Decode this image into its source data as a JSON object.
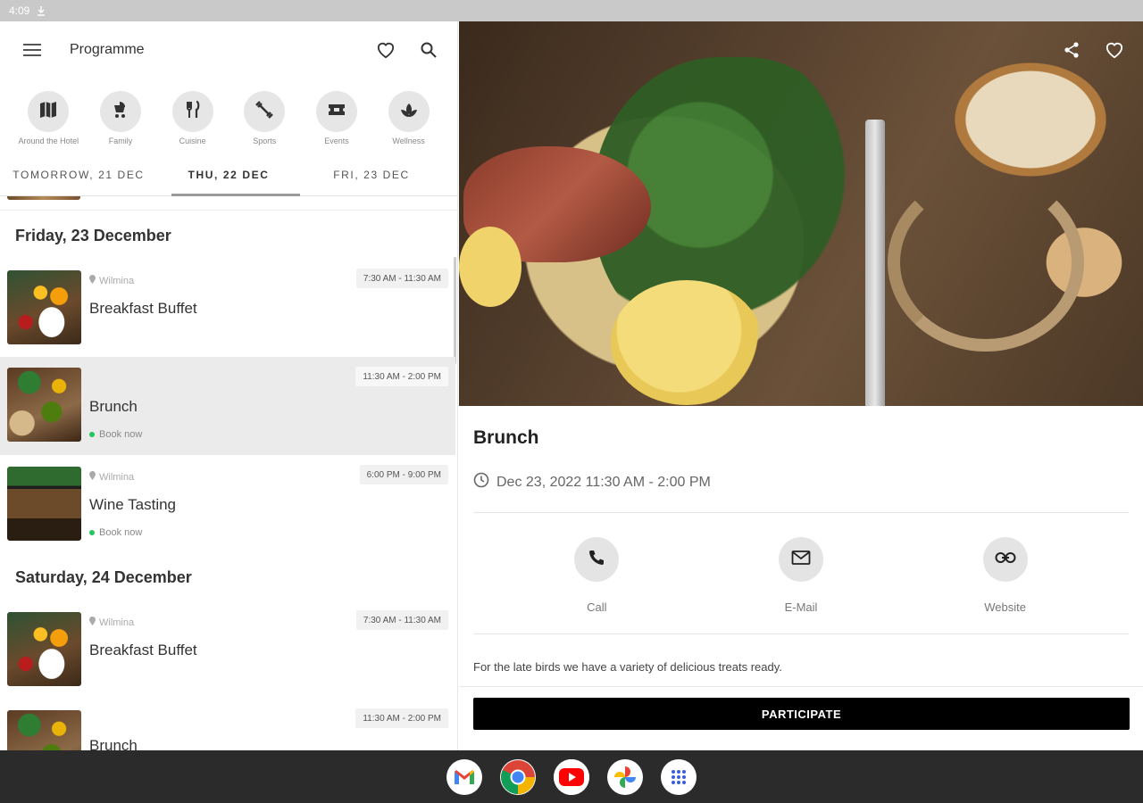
{
  "status": {
    "time": "4:09"
  },
  "appbar": {
    "title": "Programme"
  },
  "categories": [
    {
      "label": "Around the Hotel",
      "icon": "map-icon"
    },
    {
      "label": "Family",
      "icon": "stroller-icon"
    },
    {
      "label": "Cuisine",
      "icon": "fork-knife-icon"
    },
    {
      "label": "Sports",
      "icon": "fitness-icon"
    },
    {
      "label": "Events",
      "icon": "ticket-icon"
    },
    {
      "label": "Wellness",
      "icon": "lotus-icon"
    }
  ],
  "tabs": [
    "Tomorrow, 21 Dec",
    "Thu, 22 Dec",
    "Fri, 23 Dec"
  ],
  "list": {
    "day1": "Friday, 23 December",
    "day2": "Saturday, 24 December",
    "items": [
      {
        "name": "Breakfast Buffet",
        "location": "Wilmina",
        "time": "7:30 AM - 11:30 AM"
      },
      {
        "name": "Brunch",
        "time": "11:30 AM - 2:00 PM",
        "book": "Book now"
      },
      {
        "name": "Wine Tasting",
        "location": "Wilmina",
        "time": "6:00 PM - 9:00 PM",
        "book": "Book now"
      },
      {
        "name": "Breakfast Buffet",
        "location": "Wilmina",
        "time": "7:30 AM - 11:30 AM"
      },
      {
        "name": "Brunch",
        "time": "11:30 AM - 2:00 PM"
      }
    ]
  },
  "detail": {
    "title": "Brunch",
    "when": "Dec 23, 2022 11:30 AM - 2:00 PM",
    "contacts": {
      "call": "Call",
      "email": "E-Mail",
      "website": "Website"
    },
    "description": "For the late birds we have a variety of delicious treats ready.",
    "participate": "PARTICIPATE"
  },
  "taskbar": [
    "Gmail",
    "Chrome",
    "YouTube",
    "Photos",
    "Apps"
  ]
}
